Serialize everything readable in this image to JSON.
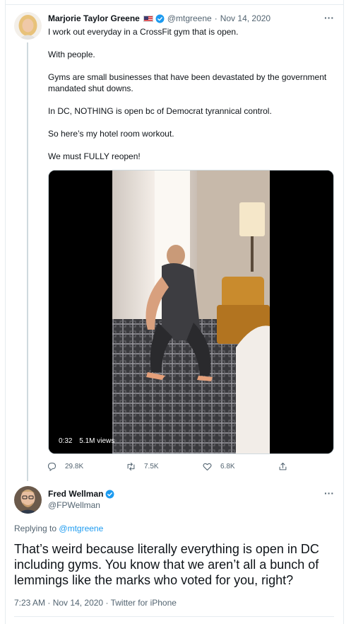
{
  "tweet": {
    "author_name": "Marjorie Taylor Greene",
    "handle": "@mtgreene",
    "separator": "·",
    "date": "Nov 14, 2020",
    "paragraphs": [
      "I work out everyday in a CrossFit gym that is open.",
      "With people.",
      "Gyms are small businesses that have been devastated by the government mandated shut downs.",
      "In DC, NOTHING is open bc of Democrat tyrannical control.",
      "So here’s my hotel room workout.",
      "We must FULLY reopen!"
    ],
    "video": {
      "duration": "0:32",
      "views": "5.1M views"
    },
    "actions": {
      "replies": "29.8K",
      "retweets": "7.5K",
      "likes": "6.8K"
    }
  },
  "reply": {
    "author_name": "Fred Wellman",
    "handle": "@FPWellman",
    "replying_to_label": "Replying to",
    "replying_to_handle": "@mtgreene",
    "text": "That’s weird because literally everything is open in DC including gyms. You know that we aren’t all a bunch of lemmings like the marks who voted for you, right?",
    "time": "7:23 AM",
    "separator": "·",
    "date": "Nov 14, 2020",
    "source": "Twitter for iPhone"
  },
  "icons": {
    "verified": "verified-badge-icon",
    "flag": "us-flag-icon",
    "more": "more-icon",
    "reply": "reply-icon",
    "retweet": "retweet-icon",
    "like": "heart-icon",
    "share": "share-icon"
  },
  "colors": {
    "accent": "#1d9bf0",
    "muted": "#536471",
    "text": "#0f1419"
  }
}
